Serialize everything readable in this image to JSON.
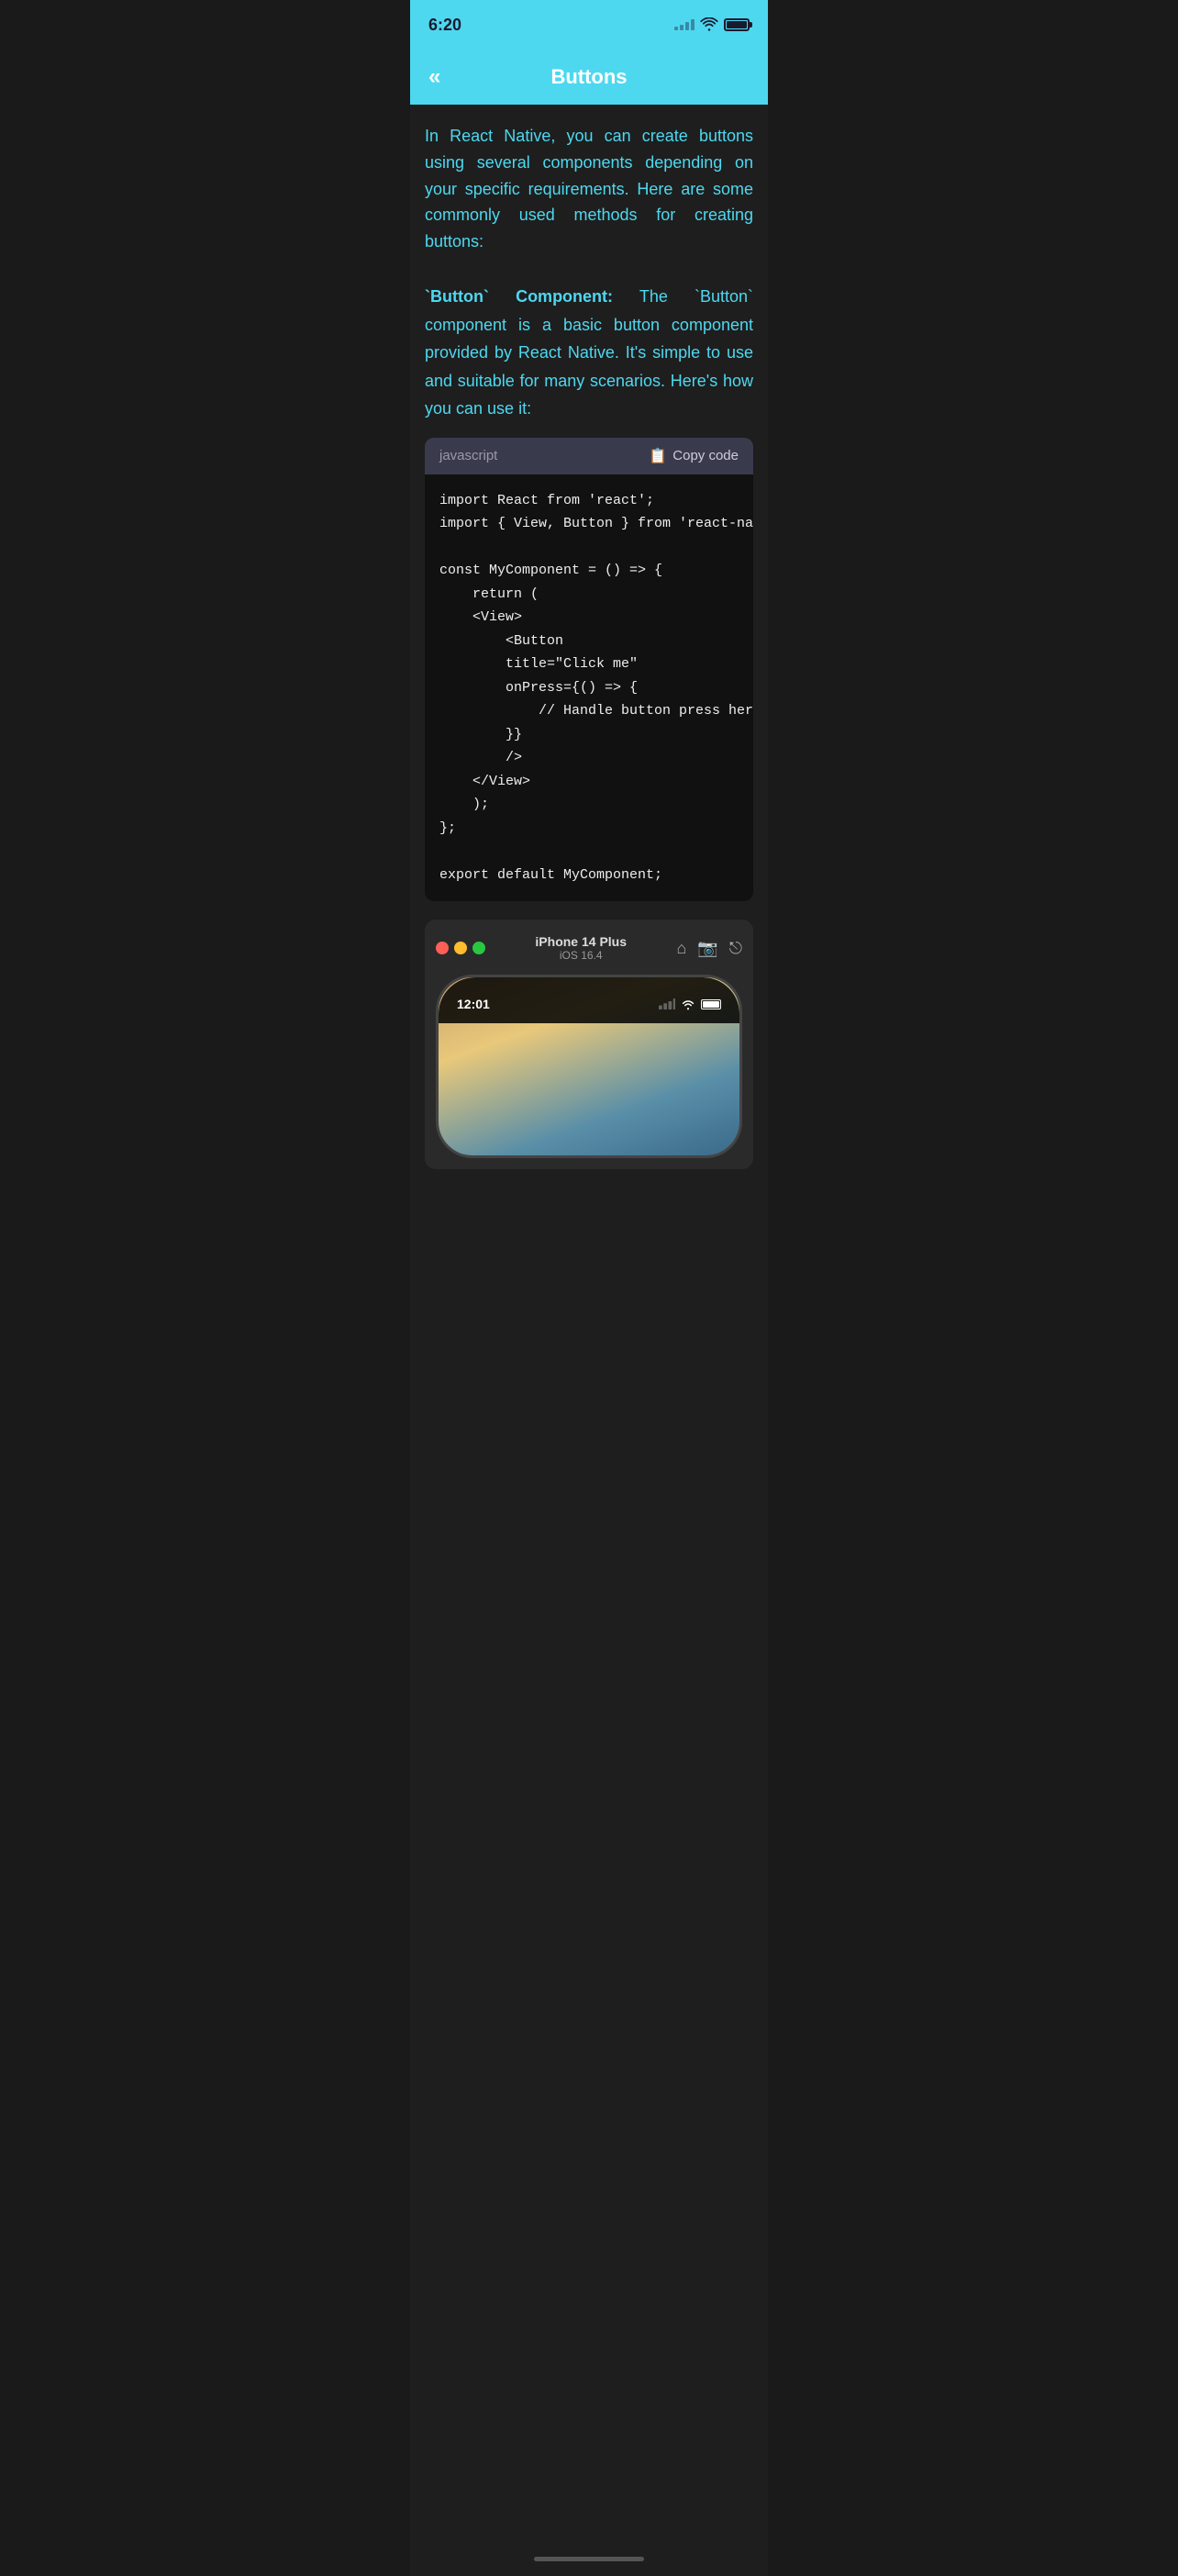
{
  "statusBar": {
    "time": "6:20",
    "colors": {
      "background": "#4dd8f0"
    }
  },
  "navBar": {
    "title": "Buttons",
    "backLabel": "«"
  },
  "content": {
    "introText": "In React Native, you can create buttons using several components depending on your specific requirements. Here are some commonly used methods for creating buttons:",
    "section1": {
      "keywordPart": "`Button` Component:",
      "descriptionPart": "  The `Button` component is a basic button component provided by React Native. It's simple to use and suitable for many scenarios. Here's how you can use it:"
    },
    "codeBlock": {
      "language": "javascript",
      "copyLabel": "Copy code",
      "code": "import React from 'react';\nimport { View, Button } from 'react-native';\n\nconst MyComponent = () => {\n    return (\n    <View>\n        <Button\n        title=\"Click me\"\n        onPress={() => {\n            // Handle button press here\n        }}\n        />\n    </View>\n    );\n};\n\nexport default MyComponent;"
    },
    "simulator": {
      "deviceName": "iPhone 14 Plus",
      "osVersion": "iOS 16.4",
      "timeDisplay": "12:01"
    }
  }
}
